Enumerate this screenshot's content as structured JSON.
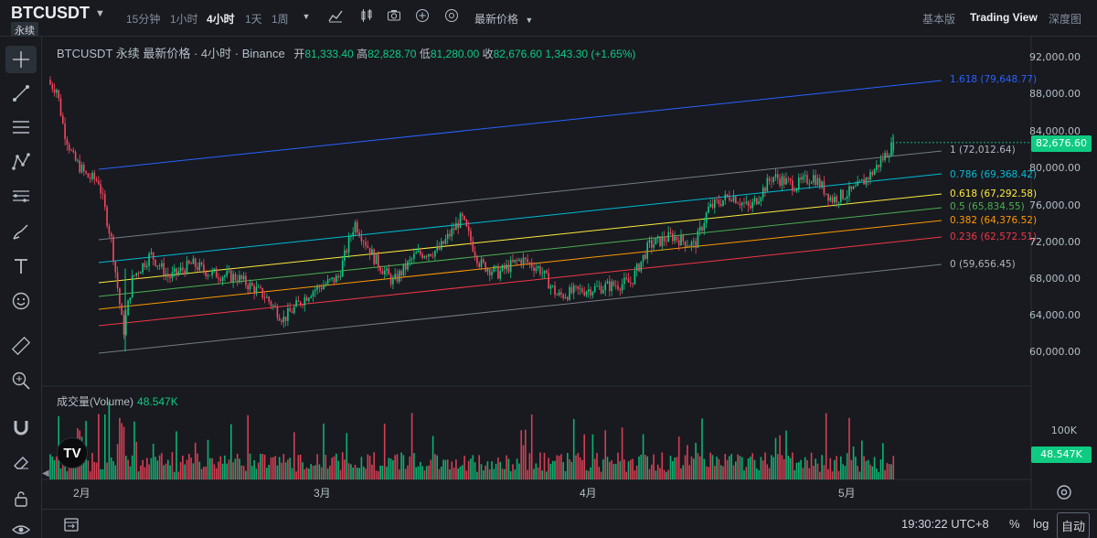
{
  "header": {
    "symbol": "BTCUSDT",
    "contract_badge": "永续",
    "timeframes": [
      "15分钟",
      "1小时",
      "4小时",
      "1天",
      "1周"
    ],
    "active_timeframe": "4小时",
    "price_type": "最新价格",
    "views": [
      "基本版",
      "Trading View",
      "深度图"
    ],
    "active_view": "Trading View"
  },
  "legend": {
    "title": "BTCUSDT 永续 最新价格 · 4小时 · Binance",
    "open_label": "开",
    "open": "81,333.40",
    "high_label": "高",
    "high": "82,828.70",
    "low_label": "低",
    "low": "81,280.00",
    "close_label": "收",
    "close": "82,676.60",
    "change": "1,343.30 (+1.65%)"
  },
  "volume": {
    "label": "成交量(Volume)",
    "value": "48.547K",
    "axis_label": "100K"
  },
  "price_axis": {
    "ticks": [
      "92,000.00",
      "88,000.00",
      "84,000.00",
      "80,000.00",
      "76,000.00",
      "72,000.00",
      "68,000.00",
      "64,000.00",
      "60,000.00"
    ],
    "current_price": "82,676.60"
  },
  "fib_levels": [
    {
      "ratio": "1.618",
      "price": "79,648.77",
      "color": "#2962ff"
    },
    {
      "ratio": "1",
      "price": "72,012.64",
      "color": "#787b86"
    },
    {
      "ratio": "0.786",
      "price": "69,368.42",
      "color": "#00bcd4"
    },
    {
      "ratio": "0.618",
      "price": "67,292.58",
      "color": "#ffeb3b"
    },
    {
      "ratio": "0.5",
      "price": "65,834.55",
      "color": "#4caf50"
    },
    {
      "ratio": "0.382",
      "price": "64,376.52",
      "color": "#ff9800"
    },
    {
      "ratio": "0.236",
      "price": "62,572.51",
      "color": "#f23645"
    },
    {
      "ratio": "0",
      "price": "59,656.45",
      "color": "#787b86"
    }
  ],
  "time_axis": [
    "2月",
    "3月",
    "4月",
    "5月"
  ],
  "footer": {
    "clock": "19:30:22 UTC+8",
    "percent": "%",
    "log": "log",
    "auto": "自动"
  },
  "colors": {
    "up": "#0ecb81",
    "down": "#f6465d",
    "background": "#181a20"
  },
  "icons": [
    "crosshair-icon",
    "trend-line-icon",
    "horizontal-lines-icon",
    "pattern-icon",
    "fib-tool-icon",
    "brush-icon",
    "text-icon",
    "emoji-icon",
    "ruler-icon",
    "zoom-in-icon",
    "magnet-icon",
    "eraser-icon",
    "lock-icon",
    "eye-icon"
  ]
}
